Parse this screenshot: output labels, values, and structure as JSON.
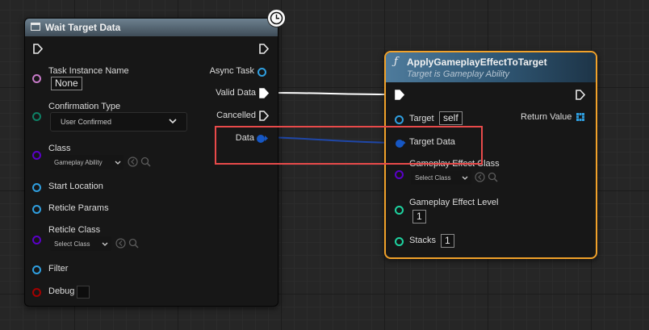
{
  "wait_node": {
    "title": "Wait Target Data",
    "inputs": {
      "task_instance_name": {
        "label": "Task Instance Name",
        "value": "None"
      },
      "confirmation_type": {
        "label": "Confirmation Type",
        "value": "User Confirmed"
      },
      "class": {
        "label": "Class",
        "value": "Gameplay Ability"
      },
      "start_location": {
        "label": "Start Location"
      },
      "reticle_params": {
        "label": "Reticle Params"
      },
      "reticle_class": {
        "label": "Reticle Class",
        "value": "Select Class"
      },
      "filter": {
        "label": "Filter"
      },
      "debug": {
        "label": "Debug"
      }
    },
    "outputs": {
      "async_task": "Async Task",
      "valid_data": "Valid Data",
      "cancelled": "Cancelled",
      "data": "Data"
    }
  },
  "apply_node": {
    "title": "ApplyGameplayEffectToTarget",
    "subtitle": "Target is Gameplay Ability",
    "inputs": {
      "target": {
        "label": "Target",
        "value": "self"
      },
      "target_data": {
        "label": "Target Data"
      },
      "gameplay_effect_class": {
        "label": "Gameplay Effect Class",
        "value": "Select Class"
      },
      "gameplay_effect_level": {
        "label": "Gameplay Effect Level",
        "value": "1"
      },
      "stacks": {
        "label": "Stacks",
        "value": "1"
      }
    },
    "outputs": {
      "return_value": "Return Value"
    }
  },
  "colors": {
    "object_pin": "#2f9fe0",
    "struct_pin": "#1657c4",
    "name_pin": "#c67ac7",
    "byte_pin": "#0e8065",
    "class_pin": "#5a00c8",
    "int_pin": "#1ed3a0",
    "bool_pin": "#a50000",
    "exec_wire": "#ffffff",
    "data_wire": "#1f47a8",
    "selection": "#f0a12a",
    "highlight": "#e84a4a"
  },
  "icons": [
    "window-icon",
    "function-icon",
    "clock-icon",
    "exec-pin-icon",
    "chevron-down-icon",
    "browse-icon",
    "search-icon",
    "array-icon"
  ]
}
